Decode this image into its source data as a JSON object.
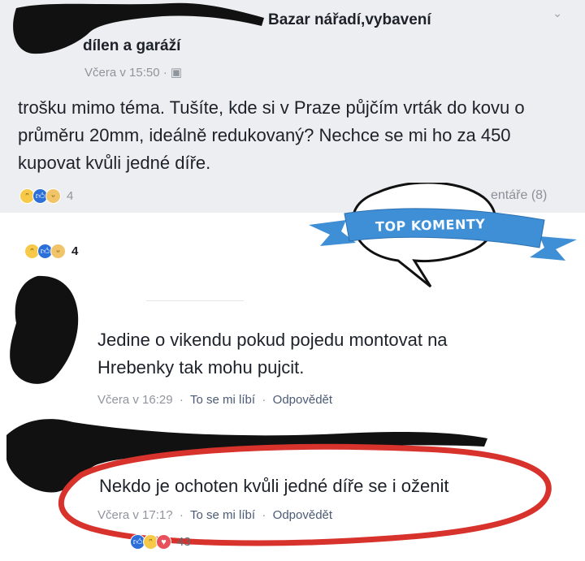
{
  "post": {
    "group_line1": "Bazar nářadí,vybavení",
    "group_line2": "dílen a garáží",
    "meta": "Včera v 15:50 · ",
    "text": "trošku mimo téma. Tušíte, kde si v Praze půjčím vrták do kovu o průměru 20mm, ideálně redukovaný? Nechce se mi ho za 450 kupovat kvůli jedné díře.",
    "reaction_count": "4",
    "comments_link": "entáře (8)"
  },
  "overlay": {
    "ribbon": "TOP KOMENTY"
  },
  "reactions_lower": {
    "count": "4"
  },
  "comments": [
    {
      "text_line1": "Jedine o vikendu pokud pojedu montovat na",
      "text_line2": "Hrebenky tak mohu pujcit.",
      "time": "Včera v 16:29",
      "like": "To se mi líbí",
      "reply": "Odpovědět"
    },
    {
      "text": "Nekdo je ochoten kvůli jedné díře se i oženit",
      "time": "Včera v 17:1?",
      "like": "To se mi líbí",
      "reply": "Odpovědět",
      "reaction_count": "43"
    }
  ],
  "colors": {
    "annotation_red": "#d8322c",
    "ribbon_blue": "#3f8fd6",
    "link_blue": "#4b5b76"
  }
}
